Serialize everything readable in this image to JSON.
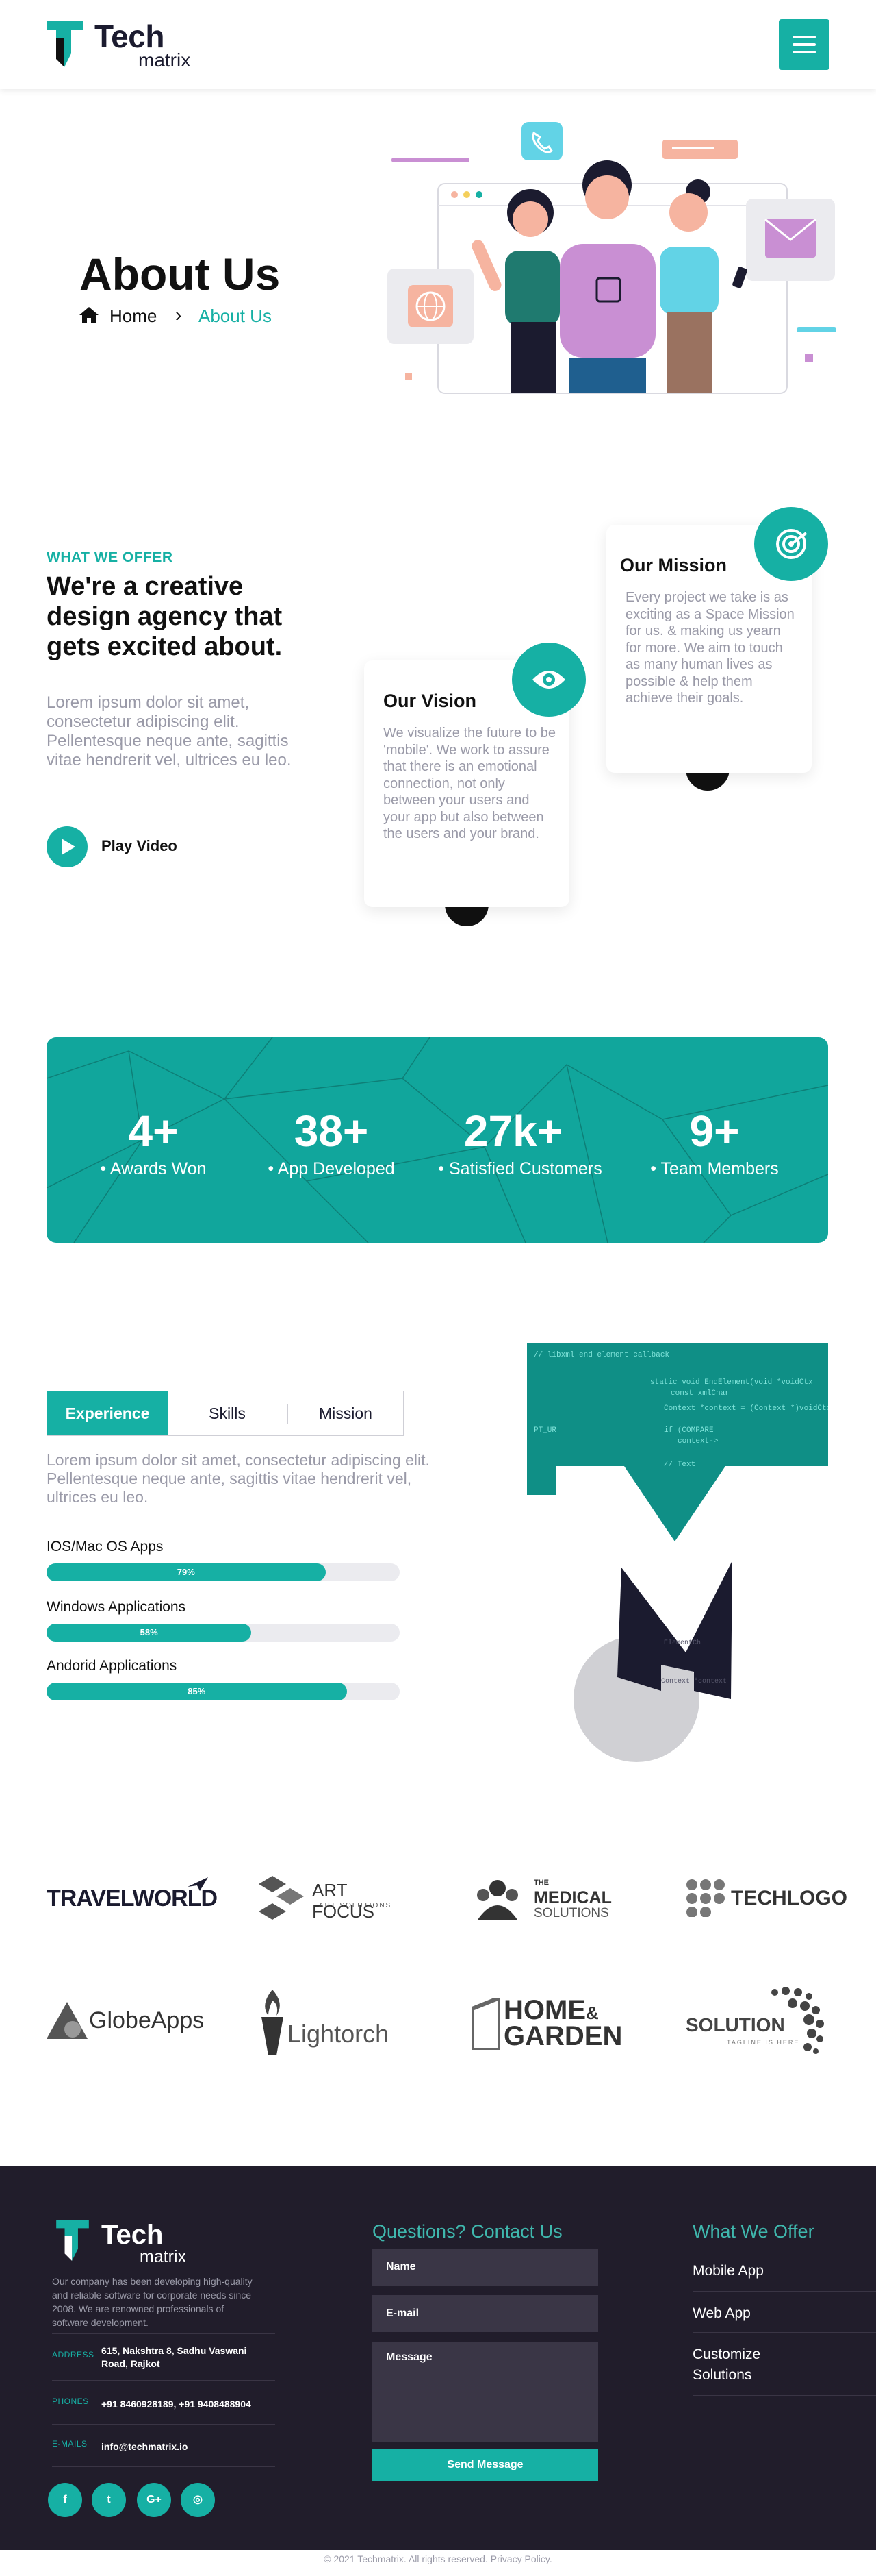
{
  "header": {
    "logo_title": "Tech",
    "logo_subtitle": "matrix",
    "menu_icon": "hamburger-icon"
  },
  "hero": {
    "title": "About Us",
    "breadcrumb": {
      "home": "Home",
      "separator": "›",
      "current": "About Us"
    }
  },
  "offer": {
    "eyebrow": "WHAT WE OFFER",
    "heading": "We're a creative design agency that gets excited about.",
    "body": "Lorem ipsum dolor sit amet, consectetur adipiscing elit. Pellentesque neque ante, sagittis vitae hendrerit vel, ultrices eu leo.",
    "play_label": "Play Video"
  },
  "cards": {
    "mission": {
      "title": "Our Mission",
      "body": "Every project we take is as exciting as a Space Mission for us. & making us yearn for more. We aim to touch as many human lives as possible & help them achieve their goals.",
      "icon": "target-icon"
    },
    "vision": {
      "title": "Our Vision",
      "body": "We visualize the future to be 'mobile'. We work to assure that there is an emotional connection, not only between your users and your app but also between the users and your brand.",
      "icon": "eye-icon"
    }
  },
  "stats": [
    {
      "value": "4+",
      "label": "Awards Won"
    },
    {
      "value": "38+",
      "label": "App Developed"
    },
    {
      "value": "27k+",
      "label": "Satisfied Customers"
    },
    {
      "value": "9+",
      "label": "Team Members"
    }
  ],
  "skills": {
    "tabs": [
      "Experience",
      "Skills",
      "Mission"
    ],
    "active_tab": "Experience",
    "body": "Lorem ipsum dolor sit amet, consectetur adipiscing elit. Pellentesque neque ante, sagittis vitae hendrerit vel, ultrices eu leo.",
    "bars": [
      {
        "label": "IOS/Mac OS Apps",
        "value": 79,
        "text": "79%"
      },
      {
        "label": "Windows Applications",
        "value": 58,
        "text": "58%"
      },
      {
        "label": "Andorid Applications",
        "value": 85,
        "text": "85%"
      }
    ]
  },
  "brands": {
    "travelworld": "TRAVELWORLD",
    "artfocus": "ART FOCUS",
    "artfocus_sub": "ART SOLUTIONS",
    "medical_the": "THE",
    "medical": "MEDICAL",
    "medical_sub": "SOLUTIONS",
    "techlogo": "TECHLOGO",
    "globeapps": "GlobeApps",
    "lightorch": "Lightorch",
    "home": "HOME",
    "garden": "GARDEN",
    "solution": "SOLUTION",
    "solution_sub": "TAGLINE IS HERE"
  },
  "footer": {
    "logo_title": "Tech",
    "logo_subtitle": "matrix",
    "about": "Our company has been developing high-quality and reliable software for corporate needs since 2008. We are renowned professionals of software development.",
    "address_label": "ADDRESS",
    "address": "615, Nakshtra 8, Sadhu Vaswani Road, Rajkot",
    "phones_label": "PHONES",
    "phones": "+91 8460928189, +91 9408488904",
    "emails_label": "E-MAILS",
    "email": "info@techmatrix.io",
    "social": [
      "f",
      "t",
      "G+",
      "◎"
    ],
    "contact_heading": "Questions? Contact Us",
    "name_placeholder": "Name",
    "email_placeholder": "E-mail",
    "message_placeholder": "Message",
    "send_label": "Send Message",
    "offer_heading": "What We Offer",
    "offer_links": [
      "Mobile App",
      "Web App",
      "Customize Solutions"
    ],
    "copyright": "© 2021 Techmatrix. All rights reserved. Privacy Policy."
  },
  "colors": {
    "accent": "#16b0a4",
    "dark": "#211d2b",
    "muted_text": "#9a9aa8"
  }
}
